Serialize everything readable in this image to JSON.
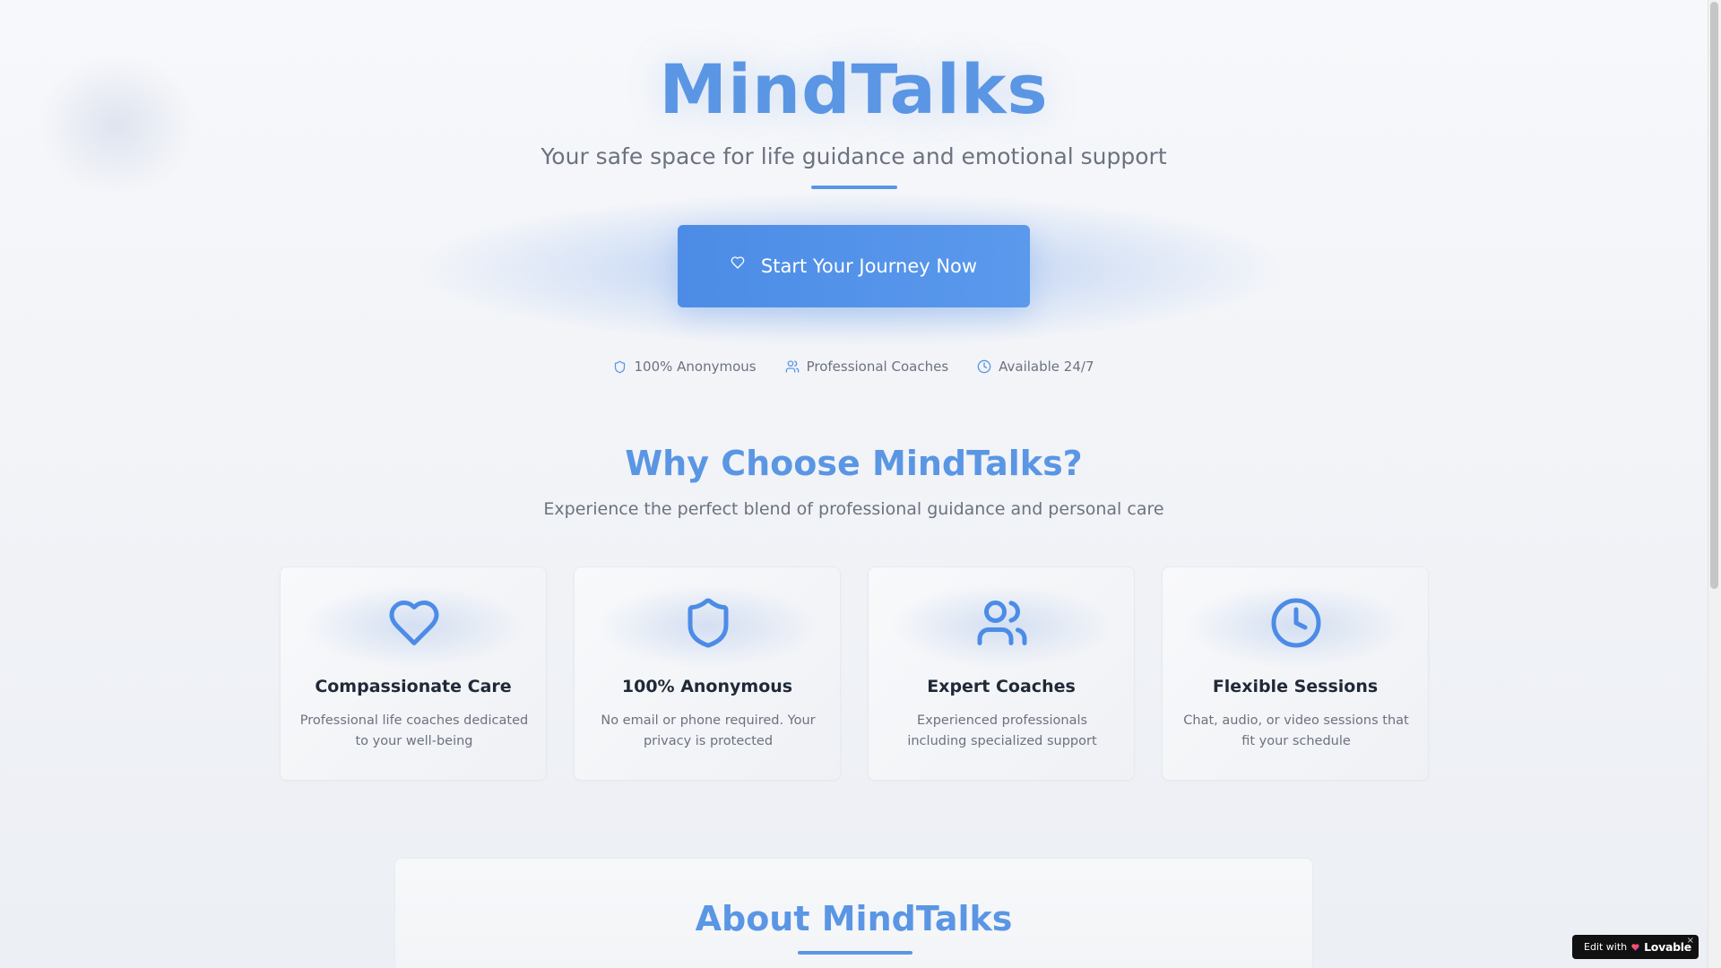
{
  "hero": {
    "title": "MindTalks",
    "subtitle": "Your safe space for life guidance and emotional support",
    "cta_label": "Start Your Journey Now",
    "cta_icon": "heart-icon"
  },
  "badges": [
    {
      "icon": "shield-icon",
      "label": "100% Anonymous"
    },
    {
      "icon": "users-icon",
      "label": "Professional Coaches"
    },
    {
      "icon": "clock-icon",
      "label": "Available 24/7"
    }
  ],
  "features": {
    "title": "Why Choose MindTalks?",
    "subtitle": "Experience the perfect blend of professional guidance and personal care",
    "cards": [
      {
        "icon": "heart-icon",
        "title": "Compassionate Care",
        "description": "Professional life coaches dedicated to your well-being"
      },
      {
        "icon": "shield-icon",
        "title": "100% Anonymous",
        "description": "No email or phone required. Your privacy is protected"
      },
      {
        "icon": "users-icon",
        "title": "Expert Coaches",
        "description": "Experienced professionals including specialized support"
      },
      {
        "icon": "clock-icon",
        "title": "Flexible Sessions",
        "description": "Chat, audio, or video sessions that fit your schedule"
      }
    ]
  },
  "about": {
    "title": "About MindTalks"
  },
  "lovable_badge": {
    "prefix": "Edit with",
    "brand": "Lovable",
    "close": "×"
  },
  "colors": {
    "accent": "#5a96e4",
    "button": "#4c8ce6",
    "text_dark": "#1f2937",
    "text_muted": "#6b7280"
  }
}
